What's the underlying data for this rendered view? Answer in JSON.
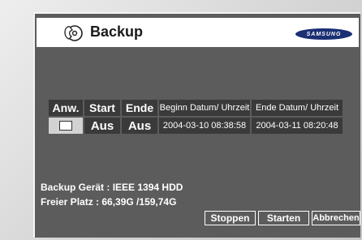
{
  "header": {
    "title": "Backup",
    "brand_logo": "SAMSUNG",
    "title_icon": "hand-disc-icon"
  },
  "schedule_table": {
    "headers": [
      "Anw.",
      "Start",
      "Ende",
      "Beginn Datum/ Uhrzeit",
      "Ende Datum/ Uhrzeit"
    ],
    "rows": [
      {
        "anw_checked": false,
        "start": "Aus",
        "ende": "Aus",
        "begin": "2004-03-10 08:38:58",
        "end": "2004-03-11 08:20:48"
      }
    ]
  },
  "info": {
    "device": "Backup Gerät : IEEE 1394 HDD",
    "free_space": "Freier Platz : 66,39G /159,74G"
  },
  "buttons": {
    "stop": "Stoppen",
    "start": "Starten",
    "cancel": "Abbrechen"
  },
  "colors": {
    "panel": "#5c5c5c",
    "cell": "#3a3a3a",
    "logo": "#1b2f72"
  }
}
